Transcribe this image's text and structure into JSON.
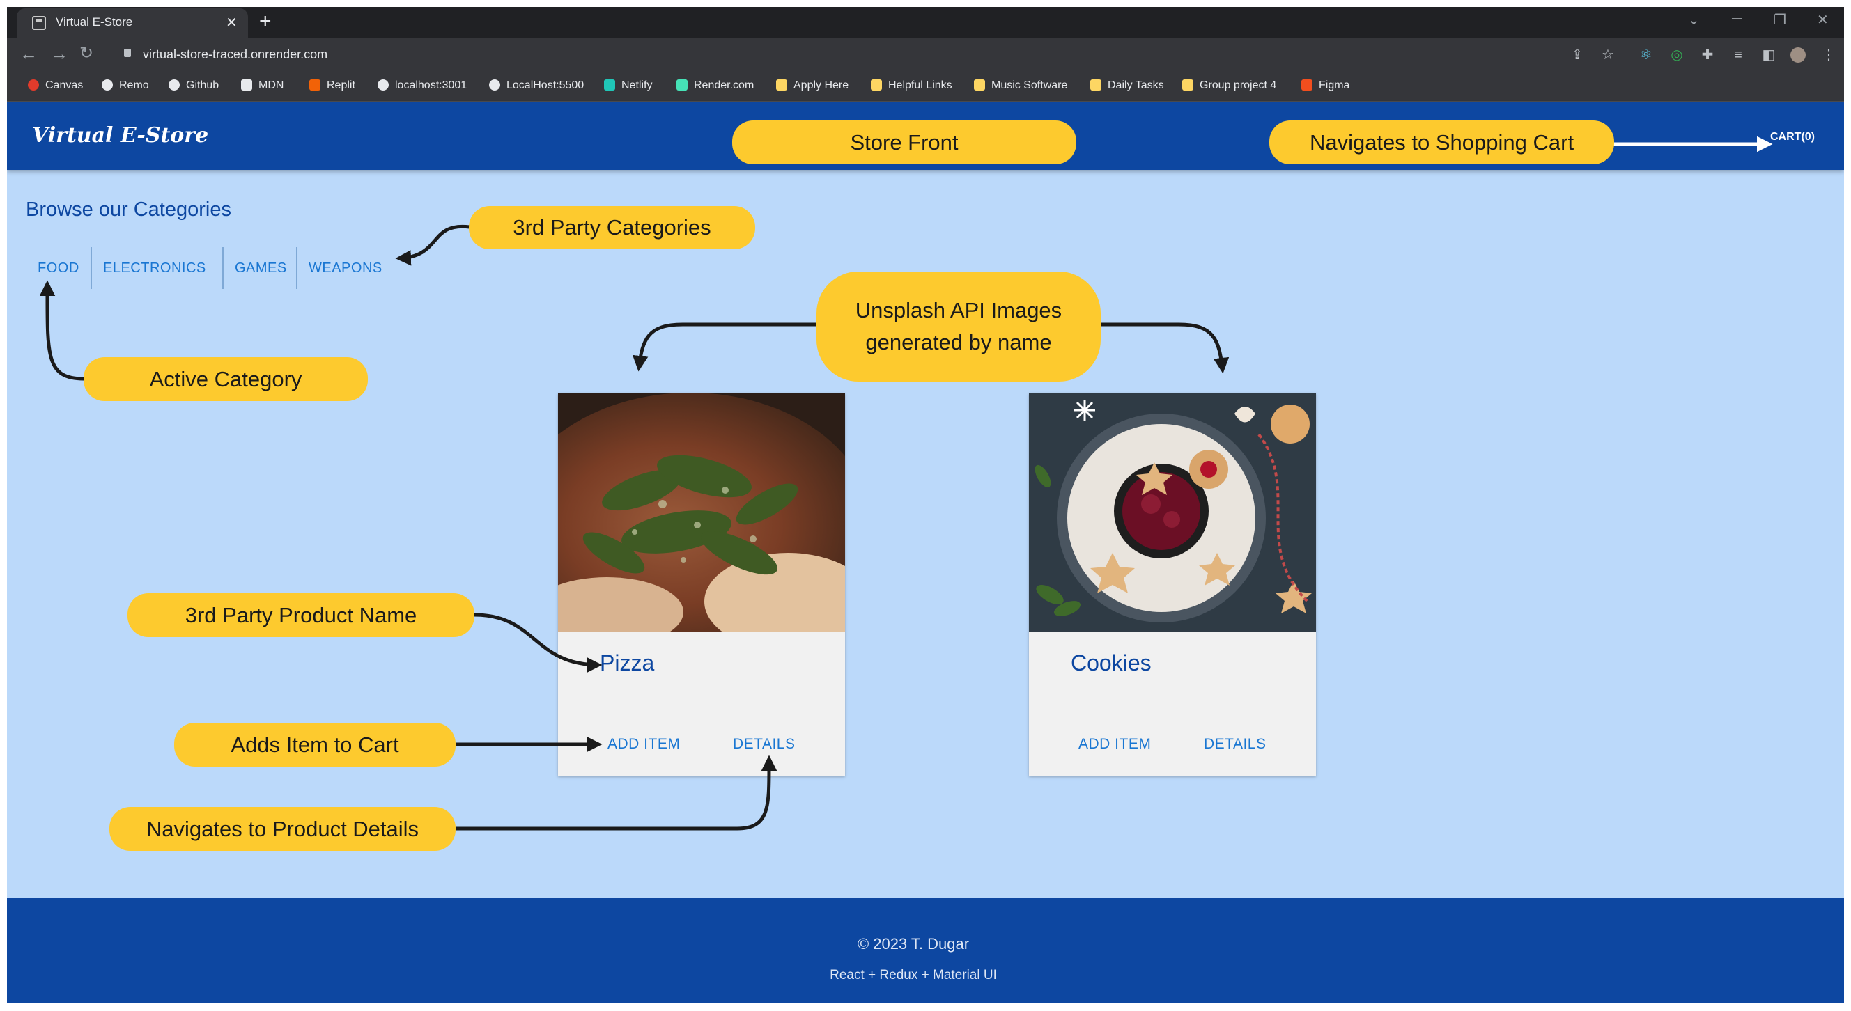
{
  "browser": {
    "tab_title": "Virtual E-Store",
    "new_tab": "+",
    "url": "virtual-store-traced.onrender.com",
    "bookmarks": [
      {
        "label": "Canvas",
        "icon": "canvas-icon",
        "color": "#e13b2b"
      },
      {
        "label": "Remo",
        "icon": "globe-icon",
        "color": "#e8eaed"
      },
      {
        "label": "Github",
        "icon": "github-icon",
        "color": "#e8eaed"
      },
      {
        "label": "MDN",
        "icon": "mdn-icon",
        "color": "#e8eaed"
      },
      {
        "label": "Replit",
        "icon": "replit-icon",
        "color": "#f26207"
      },
      {
        "label": "localhost:3001",
        "icon": "globe-icon",
        "color": "#e8eaed"
      },
      {
        "label": "LocalHost:5500",
        "icon": "globe-icon",
        "color": "#e8eaed"
      },
      {
        "label": "Netlify",
        "icon": "netlify-icon",
        "color": "#20c6b7"
      },
      {
        "label": "Render.com",
        "icon": "render-icon",
        "color": "#46e3b7"
      },
      {
        "label": "Apply Here",
        "icon": "folder-icon",
        "color": "#fdd663"
      },
      {
        "label": "Helpful Links",
        "icon": "folder-icon",
        "color": "#fdd663"
      },
      {
        "label": "Music Software",
        "icon": "folder-icon",
        "color": "#fdd663"
      },
      {
        "label": "Daily Tasks",
        "icon": "folder-icon",
        "color": "#fdd663"
      },
      {
        "label": "Group project 4",
        "icon": "folder-icon",
        "color": "#fdd663"
      },
      {
        "label": "Figma",
        "icon": "figma-icon",
        "color": "#f24e1e"
      }
    ]
  },
  "app": {
    "logo": "Virtual E-Store",
    "cart_label": "CART(0)",
    "browse_title": "Browse our Categories",
    "categories": [
      "FOOD",
      "ELECTRONICS",
      "GAMES",
      "WEAPONS"
    ],
    "active_category": "FOOD",
    "products": [
      {
        "name": "Pizza",
        "add_label": "ADD ITEM",
        "details_label": "DETAILS"
      },
      {
        "name": "Cookies",
        "add_label": "ADD ITEM",
        "details_label": "DETAILS"
      }
    ],
    "footer": {
      "copyright": "© 2023 T. Dugar",
      "stack": "React + Redux + Material UI"
    }
  },
  "annotations": {
    "store_front": "Store Front",
    "nav_cart": "Navigates to Shopping Cart",
    "third_party_categories": "3rd Party Categories",
    "active_category": "Active Category",
    "unsplash_line1": "Unsplash API Images",
    "unsplash_line2": "generated by name",
    "product_name": "3rd Party Product Name",
    "adds_item": "Adds Item to Cart",
    "nav_details": "Navigates to Product Details"
  },
  "colors": {
    "appbar": "#0d47a1",
    "page_bg": "#bbd9fa",
    "accent": "#1976d2",
    "callout": "#fdca2e"
  }
}
